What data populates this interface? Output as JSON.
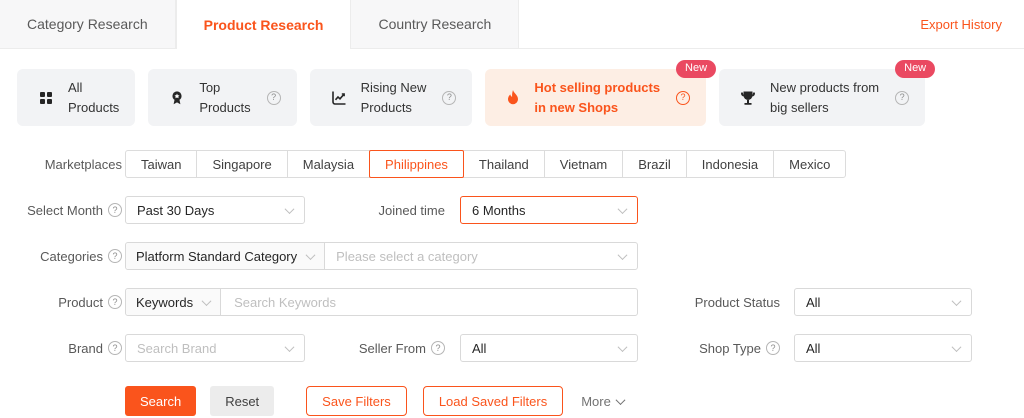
{
  "colors": {
    "accent": "#fa541c",
    "badge": "#ea4961",
    "hot_bg": "#fdeee4"
  },
  "tabs": [
    {
      "label": "Category Research"
    },
    {
      "label": "Product Research"
    },
    {
      "label": "Country Research"
    }
  ],
  "export_history": "Export History",
  "modes": [
    {
      "line1": "All",
      "line2": "Products",
      "icon": "grid-icon"
    },
    {
      "line1": "Top",
      "line2": "Products",
      "icon": "medal-icon"
    },
    {
      "line1": "Rising New",
      "line2": "Products",
      "icon": "trend-icon"
    },
    {
      "line1": "Hot selling products",
      "line2": "in new Shops",
      "icon": "flame-icon",
      "badge": "New"
    },
    {
      "line1": "New products from",
      "line2": "big sellers",
      "icon": "trophy-icon",
      "badge": "New"
    }
  ],
  "marketplaces": {
    "label": "Marketplaces",
    "options": [
      "Taiwan",
      "Singapore",
      "Malaysia",
      "Philippines",
      "Thailand",
      "Vietnam",
      "Brazil",
      "Indonesia",
      "Mexico"
    ],
    "selected": "Philippines"
  },
  "filters": {
    "select_month": {
      "label": "Select Month",
      "value": "Past 30 Days"
    },
    "joined_time": {
      "label": "Joined time",
      "value": "6 Months"
    },
    "categories": {
      "label": "Categories",
      "type_value": "Platform Standard Category",
      "placeholder": "Please select a category"
    },
    "product": {
      "label": "Product",
      "type_value": "Keywords",
      "placeholder": "Search Keywords"
    },
    "product_status": {
      "label": "Product Status",
      "value": "All"
    },
    "brand": {
      "label": "Brand",
      "placeholder": "Search Brand"
    },
    "seller_from": {
      "label": "Seller From",
      "value": "All"
    },
    "shop_type": {
      "label": "Shop Type",
      "value": "All"
    }
  },
  "actions": {
    "search": "Search",
    "reset": "Reset",
    "save_filters": "Save Filters",
    "load_saved_filters": "Load Saved Filters",
    "more": "More"
  }
}
